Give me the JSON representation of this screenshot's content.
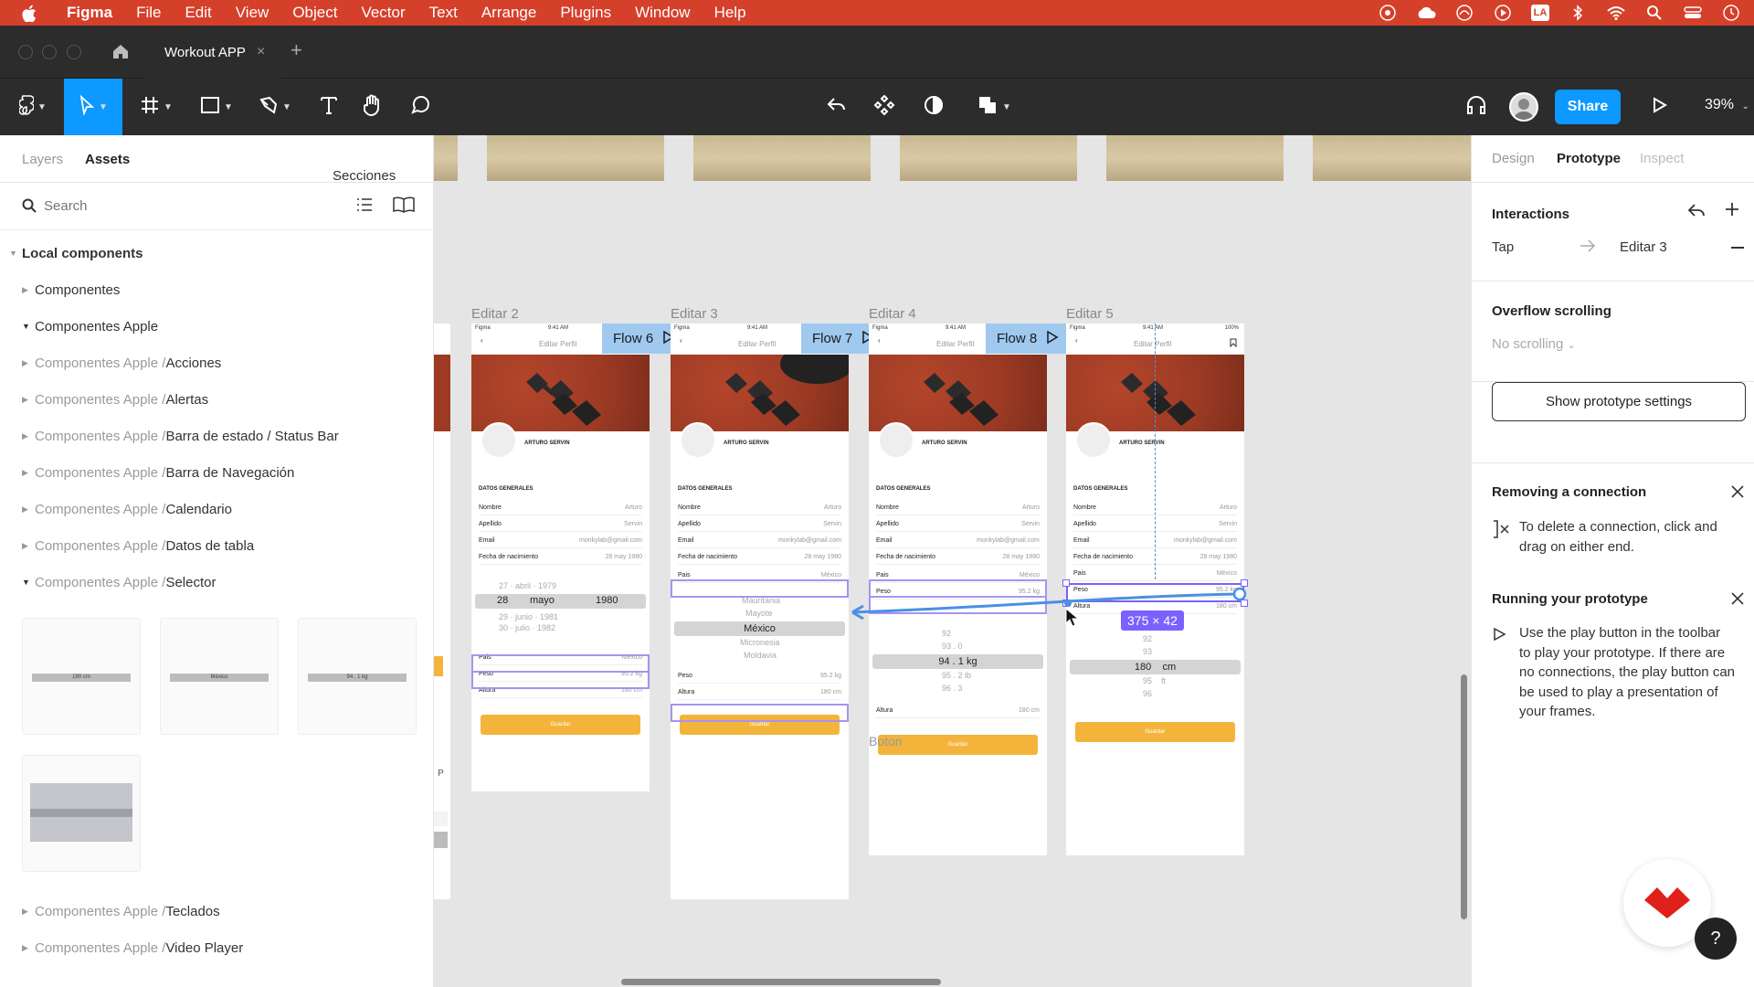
{
  "menubar": {
    "app": "Figma",
    "items": [
      "File",
      "Edit",
      "View",
      "Object",
      "Vector",
      "Text",
      "Arrange",
      "Plugins",
      "Window",
      "Help"
    ],
    "status_text": "LA"
  },
  "tabs": {
    "document_title": "Workout APP",
    "close_glyph": "×",
    "new_tab_glyph": "+"
  },
  "toolbar": {
    "share_label": "Share",
    "zoom": "39%"
  },
  "left_panel": {
    "tab_layers": "Layers",
    "tab_assets": "Assets",
    "library_dropdown": "Secciones",
    "search_placeholder": "Search",
    "local_components_label": "Local components",
    "tree": [
      {
        "prefix": "",
        "name": "Componentes"
      },
      {
        "prefix": "",
        "name": "Componentes Apple"
      },
      {
        "prefix": "Componentes Apple / ",
        "name": "Acciones"
      },
      {
        "prefix": "Componentes Apple / ",
        "name": "Alertas"
      },
      {
        "prefix": "Componentes Apple / ",
        "name": "Barra de estado / Status Bar"
      },
      {
        "prefix": "Componentes Apple / ",
        "name": "Barra de Navegación"
      },
      {
        "prefix": "Componentes Apple / ",
        "name": "Calendario"
      },
      {
        "prefix": "Componentes Apple / ",
        "name": "Datos de tabla"
      },
      {
        "prefix": "Componentes Apple / ",
        "name": "Selector"
      },
      {
        "prefix": "Componentes Apple / ",
        "name": "Teclados"
      },
      {
        "prefix": "Componentes Apple / ",
        "name": "Video Player"
      }
    ],
    "thumbs": [
      {
        "sel": "180  cm"
      },
      {
        "sel": "México"
      },
      {
        "sel": "94 . 1 kg"
      }
    ]
  },
  "canvas": {
    "frames": [
      {
        "label": "Editar 2",
        "flow": "Flow 6"
      },
      {
        "label": "Editar 3",
        "flow": "Flow 7"
      },
      {
        "label": "Editar 4",
        "flow": "Flow 8"
      },
      {
        "label": "Editar 5",
        "flow": ""
      }
    ],
    "phone": {
      "time": "9:41 AM",
      "carrier": "Figma",
      "battery": "100%",
      "nav_title": "Editar Perfil",
      "user_name": "ARTURO SERVIN",
      "section": "DATOS GENERALES",
      "rows": [
        {
          "k": "Nombre",
          "v": "Arturo"
        },
        {
          "k": "Apellido",
          "v": "Servin"
        },
        {
          "k": "Email",
          "v": "monkylab@gmail.com"
        },
        {
          "k": "Fecha de nacimiento",
          "v": "28 may 1980"
        },
        {
          "k": "Pais",
          "v": "México"
        },
        {
          "k": "Peso",
          "v": "95.2 kg"
        },
        {
          "k": "Altura",
          "v": "180 cm"
        }
      ],
      "save_label": "Guardar"
    },
    "picker_date": {
      "day": "28",
      "month": "mayo",
      "year": "1980"
    },
    "picker_country": {
      "above": [
        "Mauritania",
        "Mayote"
      ],
      "selected": "México",
      "below": [
        "Micronesia",
        "Moldavia"
      ]
    },
    "picker_weight": {
      "above": [
        "92",
        "93 . 0"
      ],
      "selected": "94 . 1 kg",
      "below": [
        "95 . 2 lb",
        "96 . 3"
      ]
    },
    "picker_height": {
      "above": [
        "92",
        "93"
      ],
      "selected": "180    cm",
      "below": [
        "95    ft",
        "96"
      ]
    },
    "boton_label": "Boton",
    "size_badge": "375 × 42"
  },
  "right_panel": {
    "tab_design": "Design",
    "tab_prototype": "Prototype",
    "tab_inspect": "Inspect",
    "interactions_title": "Interactions",
    "trigger": "Tap",
    "destination": "Editar 3",
    "overflow_title": "Overflow scrolling",
    "overflow_value": "No scrolling",
    "settings_button": "Show prototype settings",
    "removing_title": "Removing a connection",
    "removing_text": "To delete a connection, click and drag on either end.",
    "running_title": "Running your prototype",
    "running_text": "Use the play button in the toolbar to play your prototype. If there are no connections, the play button can be used to play a presentation of your frames.",
    "help_glyph": "?"
  },
  "colors": {
    "menubar": "#d5402b",
    "accent": "#0d99ff",
    "flow_badge": "#9fc9ef",
    "prototype_line": "#4a90e2",
    "selection": "#7b61ff",
    "save_button": "#f4b43c"
  }
}
